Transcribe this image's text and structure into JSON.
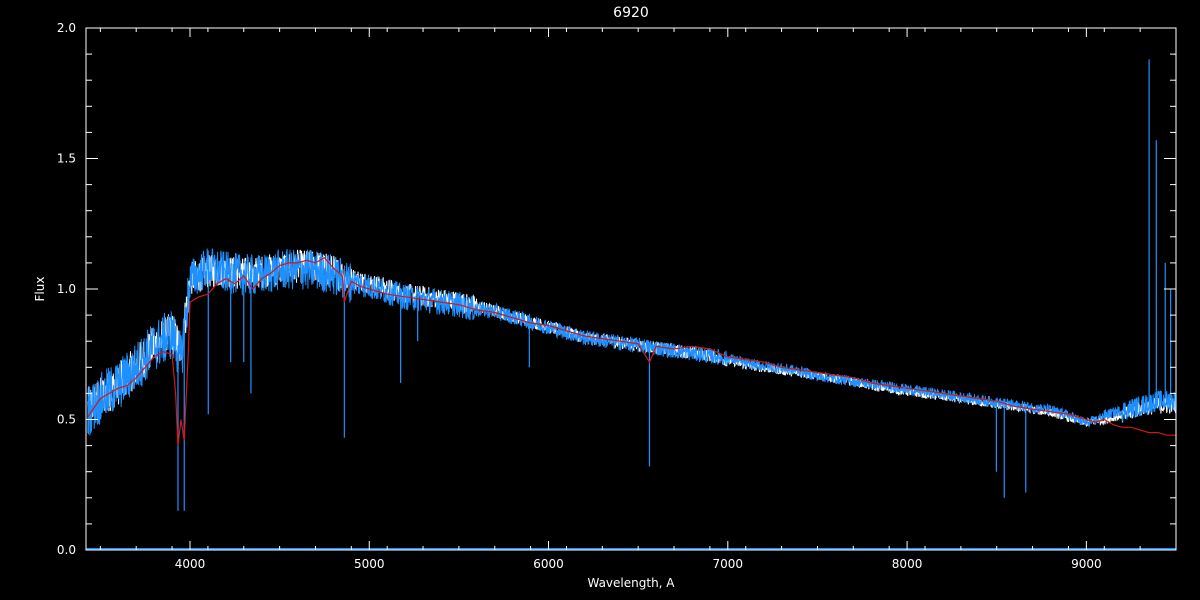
{
  "chart_data": {
    "type": "line",
    "title": "6920",
    "xlabel": "Wavelength, A",
    "ylabel": "Flux",
    "xlim": [
      3420,
      9500
    ],
    "ylim": [
      0,
      2.0
    ],
    "x_ticks": [
      4000,
      5000,
      6000,
      7000,
      8000,
      9000
    ],
    "x_tick_labels": [
      "4000",
      "5000",
      "6000",
      "7000",
      "8000",
      "9000"
    ],
    "y_ticks": [
      0.0,
      0.5,
      1.0,
      1.5,
      2.0
    ],
    "y_tick_labels": [
      "0.0",
      "0.5",
      "1.0",
      "1.5",
      "2.0"
    ],
    "grid": false,
    "colors": {
      "background": "#000000",
      "axes": "#ffffff",
      "observed": "#ffffff",
      "spectrum": "#1e90ff",
      "model": "#d01818"
    },
    "series": [
      {
        "color": "#ffffff",
        "style": "observed-underlay",
        "x": [
          3430,
          3500,
          3600,
          3700,
          3800,
          3900,
          3950,
          4000,
          4100,
          4200,
          4300,
          4400,
          4500,
          4600,
          4700,
          4800,
          4900,
          5000,
          5100,
          5200,
          5300,
          5400,
          5500,
          5600,
          5700,
          5800,
          5900,
          6000,
          6100,
          6200,
          6300,
          6400,
          6500,
          6600,
          6700,
          6800,
          6900,
          7000,
          7100,
          7200,
          7300,
          7400,
          7500,
          7600,
          7700,
          7800,
          7900,
          8000,
          8100,
          8200,
          8300,
          8400,
          8500,
          8600,
          8700,
          8800,
          8900,
          9000,
          9050,
          9100,
          9200,
          9300,
          9400,
          9500
        ],
        "y": [
          0.56,
          0.6,
          0.65,
          0.72,
          0.8,
          0.85,
          0.78,
          1.05,
          1.08,
          1.08,
          1.07,
          1.08,
          1.09,
          1.1,
          1.1,
          1.08,
          1.05,
          1.03,
          1.01,
          0.99,
          0.98,
          0.97,
          0.96,
          0.94,
          0.92,
          0.9,
          0.88,
          0.86,
          0.84,
          0.82,
          0.81,
          0.8,
          0.79,
          0.78,
          0.77,
          0.76,
          0.75,
          0.73,
          0.71,
          0.7,
          0.69,
          0.68,
          0.67,
          0.66,
          0.65,
          0.63,
          0.62,
          0.61,
          0.6,
          0.59,
          0.58,
          0.57,
          0.56,
          0.55,
          0.54,
          0.53,
          0.51,
          0.49,
          0.5,
          0.5,
          0.52,
          0.55,
          0.56,
          0.56
        ]
      },
      {
        "color": "#1e90ff",
        "style": "spectrum",
        "x": [
          3430,
          3500,
          3600,
          3700,
          3800,
          3900,
          3950,
          4000,
          4100,
          4200,
          4300,
          4400,
          4500,
          4600,
          4700,
          4800,
          4900,
          5000,
          5100,
          5200,
          5300,
          5400,
          5500,
          5600,
          5700,
          5800,
          5900,
          6000,
          6100,
          6200,
          6300,
          6400,
          6500,
          6600,
          6700,
          6800,
          6900,
          7000,
          7100,
          7200,
          7300,
          7400,
          7500,
          7600,
          7700,
          7800,
          7900,
          8000,
          8100,
          8200,
          8300,
          8400,
          8500,
          8600,
          8700,
          8800,
          8900,
          9000,
          9050,
          9100,
          9200,
          9300,
          9400,
          9500
        ],
        "y": [
          0.55,
          0.6,
          0.65,
          0.72,
          0.8,
          0.85,
          0.75,
          1.05,
          1.1,
          1.08,
          1.07,
          1.07,
          1.09,
          1.09,
          1.09,
          1.07,
          1.04,
          1.02,
          1.0,
          0.98,
          0.97,
          0.96,
          0.95,
          0.93,
          0.92,
          0.9,
          0.88,
          0.86,
          0.84,
          0.82,
          0.81,
          0.8,
          0.79,
          0.78,
          0.77,
          0.76,
          0.75,
          0.74,
          0.72,
          0.71,
          0.7,
          0.69,
          0.67,
          0.66,
          0.65,
          0.64,
          0.63,
          0.62,
          0.61,
          0.6,
          0.59,
          0.58,
          0.57,
          0.56,
          0.55,
          0.54,
          0.52,
          0.49,
          0.5,
          0.52,
          0.54,
          0.56,
          0.58,
          0.58
        ],
        "absorption_lines": [
          {
            "x": 3933,
            "y": 0.15
          },
          {
            "x": 3968,
            "y": 0.15
          },
          {
            "x": 4102,
            "y": 0.52
          },
          {
            "x": 4227,
            "y": 0.72
          },
          {
            "x": 4300,
            "y": 0.72
          },
          {
            "x": 4340,
            "y": 0.6
          },
          {
            "x": 4861,
            "y": 0.43
          },
          {
            "x": 5175,
            "y": 0.64
          },
          {
            "x": 5270,
            "y": 0.8
          },
          {
            "x": 5893,
            "y": 0.7
          },
          {
            "x": 6563,
            "y": 0.32
          },
          {
            "x": 8498,
            "y": 0.3
          },
          {
            "x": 8542,
            "y": 0.2
          },
          {
            "x": 8662,
            "y": 0.22
          }
        ],
        "emission_spikes": [
          {
            "x": 9350,
            "y": 1.88
          },
          {
            "x": 9390,
            "y": 1.57
          },
          {
            "x": 9440,
            "y": 1.1
          },
          {
            "x": 9470,
            "y": 1.0
          }
        ]
      },
      {
        "color": "#d01818",
        "style": "model",
        "x": [
          3430,
          3500,
          3550,
          3600,
          3650,
          3700,
          3750,
          3800,
          3850,
          3900,
          3920,
          3933,
          3950,
          3968,
          3990,
          4000,
          4050,
          4100,
          4150,
          4200,
          4250,
          4300,
          4350,
          4400,
          4450,
          4500,
          4550,
          4600,
          4650,
          4700,
          4750,
          4800,
          4850,
          4861,
          4900,
          4950,
          5000,
          5100,
          5200,
          5300,
          5400,
          5500,
          5600,
          5700,
          5800,
          5900,
          6000,
          6100,
          6200,
          6300,
          6400,
          6500,
          6563,
          6600,
          6700,
          6800,
          6900,
          7000,
          7100,
          7200,
          7300,
          7400,
          7500,
          7600,
          7700,
          7800,
          7900,
          8000,
          8100,
          8200,
          8300,
          8400,
          8500,
          8600,
          8700,
          8800,
          8900,
          9000,
          9050,
          9100,
          9150,
          9200,
          9250,
          9300,
          9350,
          9400,
          9450,
          9500
        ],
        "y": [
          0.51,
          0.58,
          0.6,
          0.62,
          0.63,
          0.66,
          0.7,
          0.74,
          0.76,
          0.75,
          0.6,
          0.4,
          0.5,
          0.42,
          0.75,
          0.95,
          0.97,
          0.98,
          1.02,
          1.04,
          1.02,
          1.05,
          1.0,
          1.04,
          1.06,
          1.09,
          1.1,
          1.1,
          1.11,
          1.1,
          1.12,
          1.08,
          1.05,
          0.95,
          1.03,
          1.01,
          1.0,
          0.98,
          0.97,
          0.96,
          0.95,
          0.94,
          0.92,
          0.91,
          0.89,
          0.87,
          0.86,
          0.84,
          0.82,
          0.81,
          0.8,
          0.79,
          0.72,
          0.78,
          0.77,
          0.78,
          0.77,
          0.74,
          0.73,
          0.72,
          0.7,
          0.69,
          0.68,
          0.67,
          0.66,
          0.64,
          0.63,
          0.62,
          0.61,
          0.6,
          0.59,
          0.58,
          0.57,
          0.55,
          0.54,
          0.53,
          0.52,
          0.5,
          0.49,
          0.5,
          0.48,
          0.47,
          0.47,
          0.46,
          0.45,
          0.45,
          0.44,
          0.44
        ]
      }
    ]
  }
}
